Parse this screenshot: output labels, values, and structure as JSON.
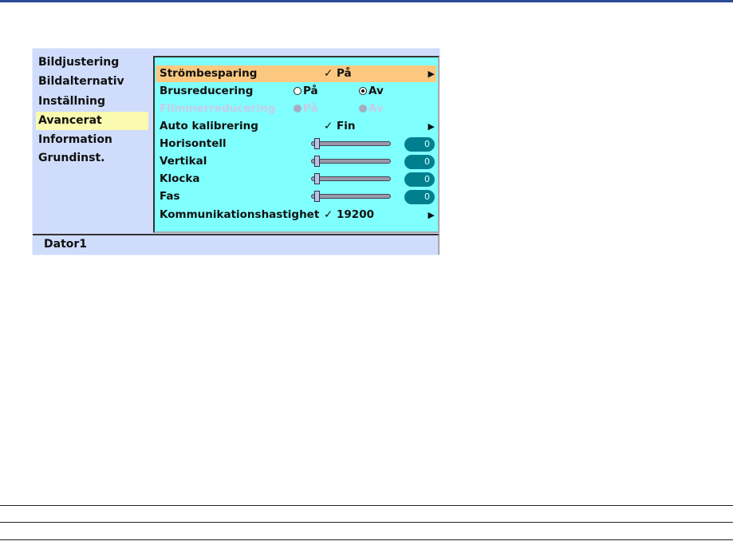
{
  "left_menu": {
    "items": [
      {
        "label": "Bildjustering"
      },
      {
        "label": "Bildalternativ"
      },
      {
        "label": "Inställning"
      },
      {
        "label": "Avancerat",
        "selected": true
      },
      {
        "label": "Information"
      },
      {
        "label": "Grundinst."
      }
    ]
  },
  "panel": {
    "power_saving": {
      "label": "Strömbesparing",
      "value": "✓ På"
    },
    "noise_reduction": {
      "label": "Brusreducering",
      "on": "På",
      "off": "Av",
      "selected": "Av"
    },
    "flicker_reduction": {
      "label": "Flimmerreducering",
      "on": "På",
      "off": "Av",
      "disabled": true
    },
    "auto_adjust": {
      "label": "Auto kalibrering",
      "value": "✓ Fin"
    },
    "sliders": [
      {
        "label": "Horisontell",
        "value": "0"
      },
      {
        "label": "Vertikal",
        "value": "0"
      },
      {
        "label": "Klocka",
        "value": "0"
      },
      {
        "label": "Fas",
        "value": "0"
      }
    ],
    "baud": {
      "label": "Kommunikationshastighet",
      "value": "✓ 19200"
    }
  },
  "status": {
    "source": "Dator1"
  },
  "colors": {
    "menu_bg": "#cfdcfc",
    "panel_bg": "#80ffff",
    "highlight": "#fcc880",
    "left_selected": "#fafab0"
  }
}
